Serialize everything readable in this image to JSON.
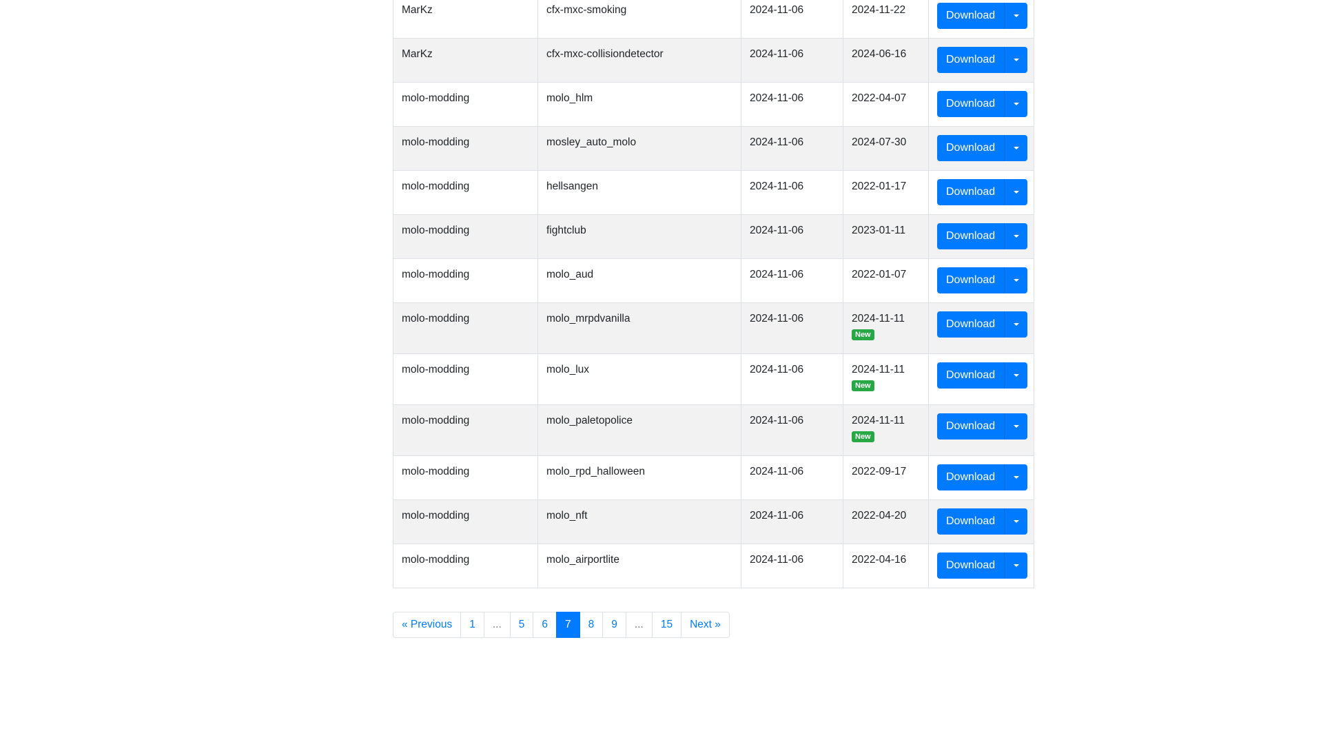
{
  "table": {
    "download_label": "Download",
    "new_badge_label": "New",
    "rows": [
      {
        "author": "MarKz",
        "name": "cfx-mxc-smoking",
        "added": "2024-11-06",
        "updated": "2024-11-22",
        "is_new": false
      },
      {
        "author": "MarKz",
        "name": "cfx-mxc-collisiondetector",
        "added": "2024-11-06",
        "updated": "2024-06-16",
        "is_new": false
      },
      {
        "author": "molo-modding",
        "name": "molo_hlm",
        "added": "2024-11-06",
        "updated": "2022-04-07",
        "is_new": false
      },
      {
        "author": "molo-modding",
        "name": "mosley_auto_molo",
        "added": "2024-11-06",
        "updated": "2024-07-30",
        "is_new": false
      },
      {
        "author": "molo-modding",
        "name": "hellsangen",
        "added": "2024-11-06",
        "updated": "2022-01-17",
        "is_new": false
      },
      {
        "author": "molo-modding",
        "name": "fightclub",
        "added": "2024-11-06",
        "updated": "2023-01-11",
        "is_new": false
      },
      {
        "author": "molo-modding",
        "name": "molo_aud",
        "added": "2024-11-06",
        "updated": "2022-01-07",
        "is_new": false
      },
      {
        "author": "molo-modding",
        "name": "molo_mrpdvanilla",
        "added": "2024-11-06",
        "updated": "2024-11-11",
        "is_new": true
      },
      {
        "author": "molo-modding",
        "name": "molo_lux",
        "added": "2024-11-06",
        "updated": "2024-11-11",
        "is_new": true
      },
      {
        "author": "molo-modding",
        "name": "molo_paletopolice",
        "added": "2024-11-06",
        "updated": "2024-11-11",
        "is_new": true
      },
      {
        "author": "molo-modding",
        "name": "molo_rpd_halloween",
        "added": "2024-11-06",
        "updated": "2022-09-17",
        "is_new": false
      },
      {
        "author": "molo-modding",
        "name": "molo_nft",
        "added": "2024-11-06",
        "updated": "2022-04-20",
        "is_new": false
      },
      {
        "author": "molo-modding",
        "name": "molo_airportlite",
        "added": "2024-11-06",
        "updated": "2022-04-16",
        "is_new": false
      }
    ]
  },
  "pagination": {
    "items": [
      {
        "label": "« Previous",
        "state": "link"
      },
      {
        "label": "1",
        "state": "link"
      },
      {
        "label": "...",
        "state": "disabled"
      },
      {
        "label": "5",
        "state": "link"
      },
      {
        "label": "6",
        "state": "link"
      },
      {
        "label": "7",
        "state": "active"
      },
      {
        "label": "8",
        "state": "link"
      },
      {
        "label": "9",
        "state": "link"
      },
      {
        "label": "...",
        "state": "disabled"
      },
      {
        "label": "15",
        "state": "link"
      },
      {
        "label": "Next »",
        "state": "link"
      }
    ]
  },
  "colors": {
    "primary": "#007bff",
    "badge_new": "#28a745",
    "row_stripe": "#f2f2f2"
  }
}
